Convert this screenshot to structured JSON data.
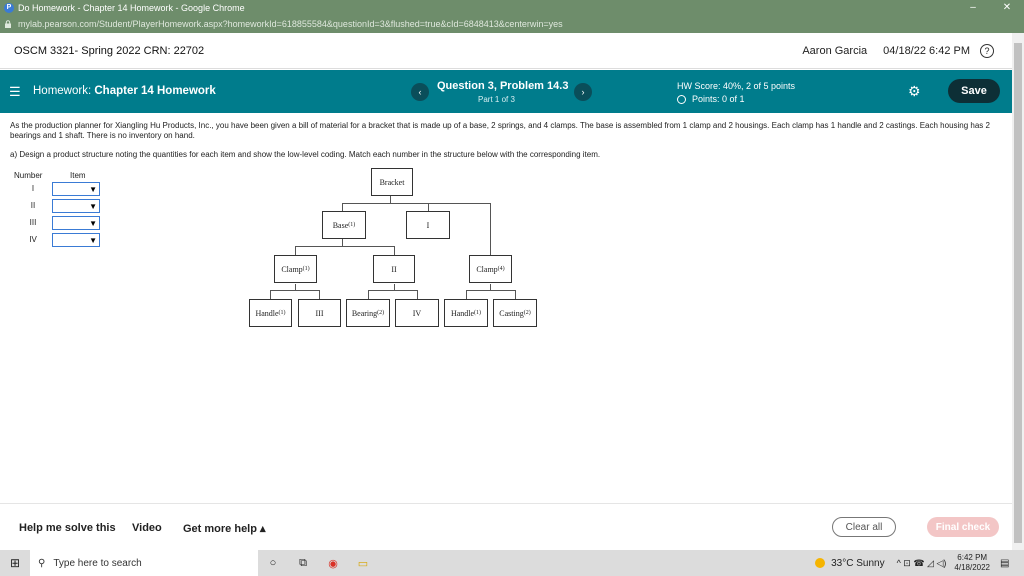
{
  "browser": {
    "title": "Do Homework - Chapter 14 Homework - Google Chrome",
    "url": "mylab.pearson.com/Student/PlayerHomework.aspx?homeworkId=618855584&questionId=3&flushed=true&cId=6848413&centerwin=yes",
    "minimize": "–",
    "close": "✕"
  },
  "course": {
    "name": "OSCM 3321- Spring 2022 CRN: 22702",
    "user": "Aaron Garcia",
    "datetime": "04/18/22 6:42 PM",
    "help": "?"
  },
  "header": {
    "menu_icon": "☰",
    "hw_prefix": "Homework:",
    "hw_name": "Chapter 14 Homework",
    "prev": "‹",
    "next": "›",
    "question_title": "Question 3, Problem 14.3",
    "question_sub": "Part 1 of 3",
    "hw_score": "HW Score: 40%, 2 of 5 points",
    "points": "Points: 0 of 1",
    "settings_icon": "⚙",
    "save": "Save"
  },
  "problem": {
    "text": "As the production planner for Xiangling Hu Products, Inc., you have been given a bill of material for a bracket that is made up of a base, 2 springs, and 4 clamps. The base is assembled from 1 clamp and 2 housings. Each clamp has 1 handle and 2 castings. Each housing has 2 bearings and 1 shaft. There is no inventory on hand.",
    "part_a": "a) Design a product structure noting the quantities for each item and show the low-level coding. Match each number in the structure below with the corresponding item."
  },
  "assign": {
    "header_number": "Number",
    "header_item": "Item",
    "rows": [
      {
        "roman": "I",
        "arrow": "▼"
      },
      {
        "roman": "II",
        "arrow": "▼"
      },
      {
        "roman": "III",
        "arrow": "▼"
      },
      {
        "roman": "IV",
        "arrow": "▼"
      }
    ]
  },
  "diagram": {
    "bracket": "Bracket",
    "base": "Base",
    "base_q": "(1)",
    "i": "I",
    "clamp1": "Clamp",
    "clamp1_q": "(1)",
    "ii": "II",
    "clamp4": "Clamp",
    "clamp4_q": "(4)",
    "handle1": "Handle",
    "handle1_q": "(1)",
    "iii": "III",
    "bearing": "Bearing",
    "bearing_q": "(2)",
    "iv": "IV",
    "handle2": "Handle",
    "handle2_q": "(1)",
    "casting": "Casting",
    "casting_q": "(2)"
  },
  "bottom": {
    "help_solve": "Help me solve this",
    "video": "Video",
    "more_help": "Get more help ▴",
    "clear_all": "Clear all",
    "final_check": "Final check"
  },
  "taskbar": {
    "start_icon": "⊞",
    "search_icon": "⚲",
    "search_placeholder": "Type here to search",
    "cortana_icon": "○",
    "taskview_icon": "⧉",
    "chrome_icon": "◉",
    "explorer_icon": "▭",
    "weather": "33°C Sunny",
    "tray": "^ ⊡ ☎ ◿ ◁)",
    "time": "6:42 PM",
    "date": "4/18/2022",
    "notify_icon": "▤"
  }
}
